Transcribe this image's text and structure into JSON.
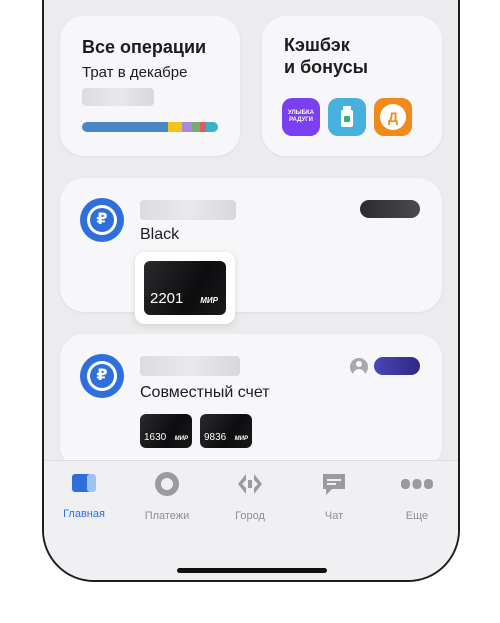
{
  "operations": {
    "title": "Все операции",
    "subtitle": "Трат в декабре"
  },
  "spend_bar_colors": [
    "#4b87c5",
    "#f2c41a",
    "#a88ad8",
    "#7ea971",
    "#db5e5e",
    "#35b4c8"
  ],
  "cashback": {
    "title_line1": "Кэшбэк",
    "title_line2": "и бонусы",
    "partner1_text": "УЛЫБКА РАДУГИ",
    "partner3_text": "Д"
  },
  "account1": {
    "name": "Black",
    "card_number": "2201",
    "card_system": "МИР"
  },
  "account2": {
    "name": "Совместный счет",
    "cards": [
      {
        "number": "1630",
        "system": "МИР"
      },
      {
        "number": "9836",
        "system": "МИР"
      }
    ]
  },
  "currency_symbol": "₽",
  "nav": [
    {
      "label": "Главная",
      "icon": "home-icon",
      "active": true
    },
    {
      "label": "Платежи",
      "icon": "payments-icon",
      "active": false
    },
    {
      "label": "Город",
      "icon": "city-icon",
      "active": false
    },
    {
      "label": "Чат",
      "icon": "chat-icon",
      "active": false
    },
    {
      "label": "Еще",
      "icon": "more-icon",
      "active": false
    }
  ],
  "colors": {
    "accent": "#2f6fdb",
    "inactive": "#8e8e93"
  }
}
